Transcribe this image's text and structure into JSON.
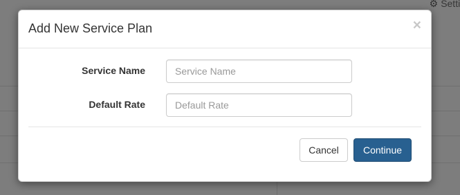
{
  "background": {
    "settings_label": "Settin"
  },
  "modal": {
    "title": "Add New Service Plan",
    "close_glyph": "×",
    "fields": [
      {
        "label": "Service Name",
        "value": "",
        "placeholder": "Service Name"
      },
      {
        "label": "Default Rate",
        "value": "",
        "placeholder": "Default Rate"
      }
    ],
    "buttons": {
      "cancel_label": "Cancel",
      "continue_label": "Continue"
    }
  },
  "colors": {
    "primary": "#286090",
    "overlay": "#7d7d7d"
  },
  "icons": {
    "settings": "gear-icon",
    "close": "close-icon"
  }
}
